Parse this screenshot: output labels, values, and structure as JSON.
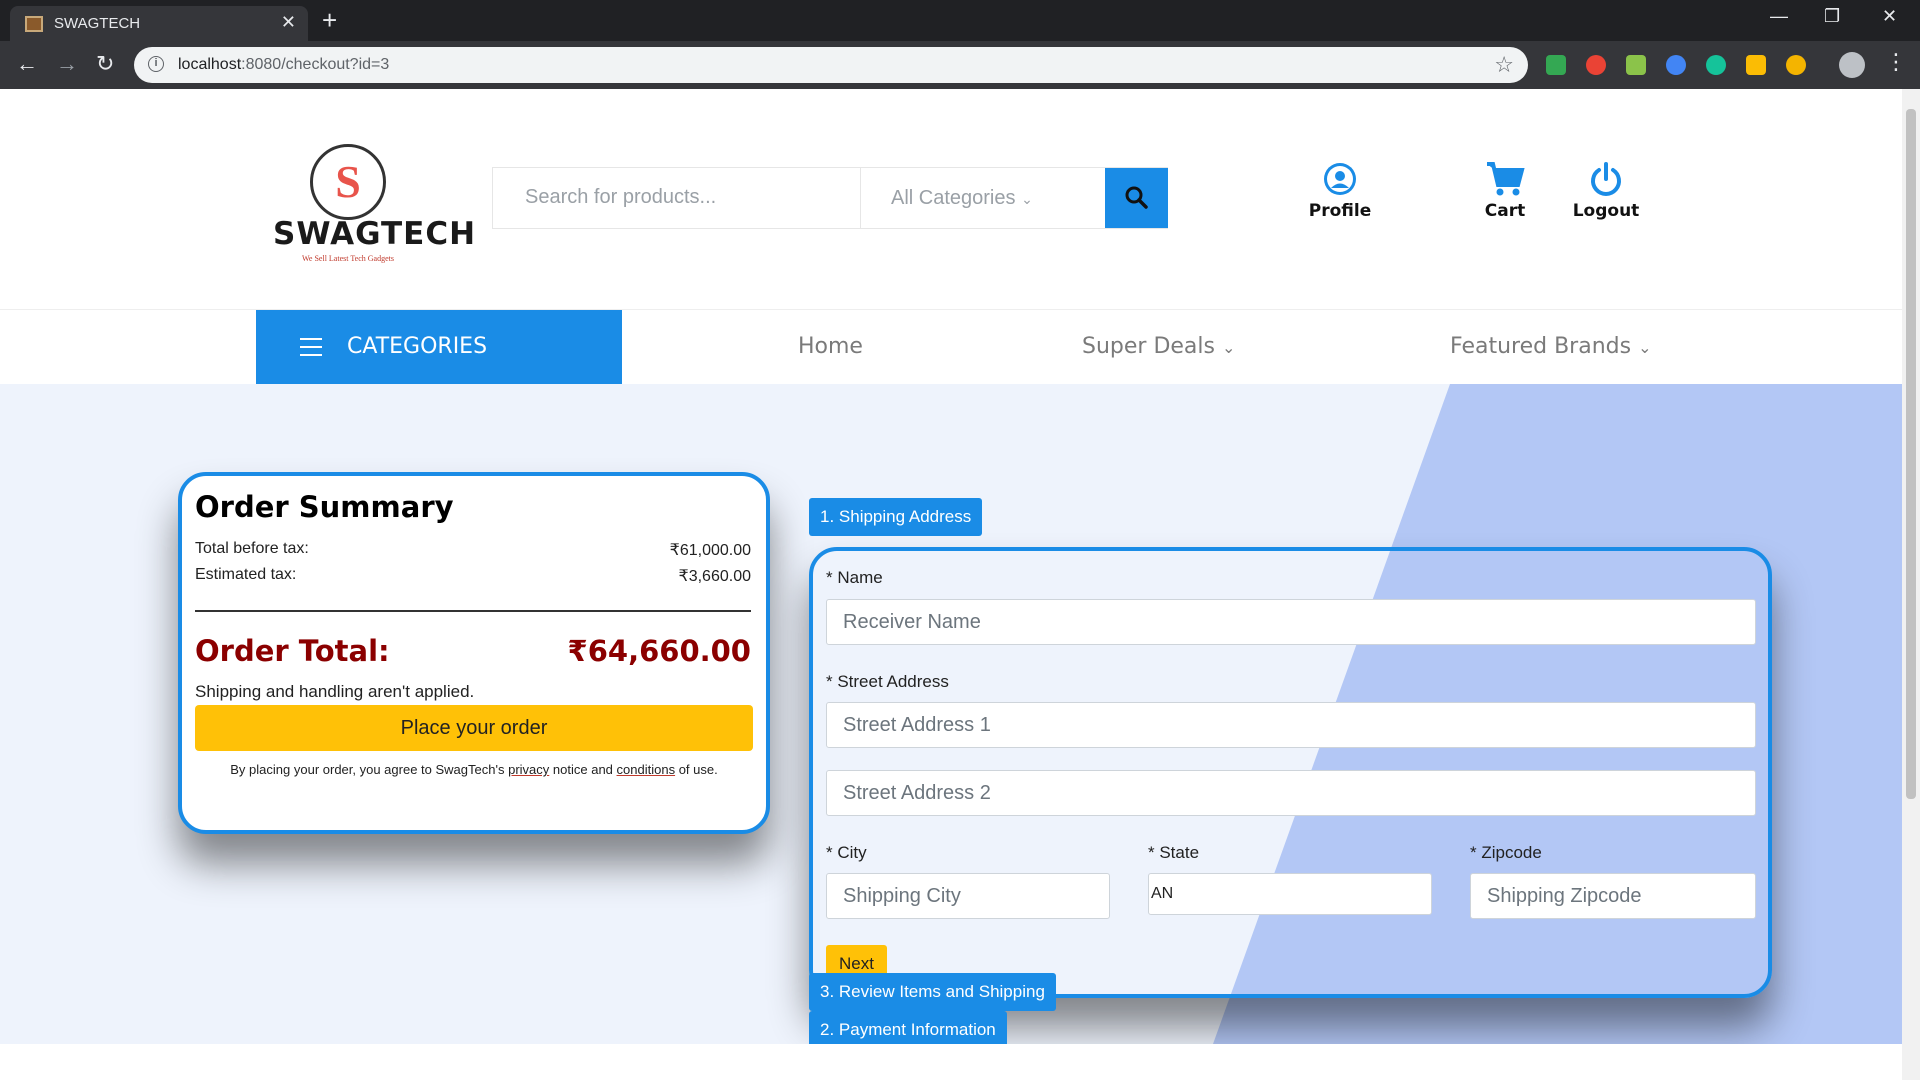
{
  "browser": {
    "tab_title": "SWAGTECH",
    "tab_close": "✕",
    "new_tab": "+",
    "url_host": "localhost",
    "url_rest": ":8080/checkout?id=3",
    "minimize": "—",
    "restore": "❐",
    "close": "✕"
  },
  "header": {
    "logo_text": "SWAGTECH",
    "logo_tagline": "We Sell Latest Tech Gadgets",
    "search_placeholder": "Search for products...",
    "category_select": "All Categories",
    "profile_label": "Profile",
    "cart_label": "Cart",
    "logout_label": "Logout"
  },
  "nav": {
    "categories_label": "CATEGORIES",
    "home": "Home",
    "super_deals": "Super Deals",
    "featured_brands": "Featured Brands"
  },
  "summary": {
    "title": "Order Summary",
    "before_tax_label": "Total before tax:",
    "before_tax_value": "₹61,000.00",
    "tax_label": "Estimated tax:",
    "tax_value": "₹3,660.00",
    "total_label": "Order Total:",
    "total_value": "₹64,660.00",
    "shipping_note": "Shipping and handling aren't applied.",
    "place_order": "Place your order",
    "legal_pre": "By placing your order, you agree to SwagTech's",
    "legal_privacy": "privacy",
    "legal_mid": "notice and",
    "legal_conditions": "conditions",
    "legal_post": "of use."
  },
  "steps": {
    "step1": "1. Shipping Address",
    "step2": "2. Payment Information",
    "step3": "3. Review Items and Shipping"
  },
  "form": {
    "name_label": "* Name",
    "name_placeholder": "Receiver Name",
    "street_label": "* Street Address",
    "street1_placeholder": "Street Address 1",
    "street2_placeholder": "Street Address 2",
    "city_label": "* City",
    "city_placeholder": "Shipping City",
    "state_label": "* State",
    "state_value": "AN",
    "zip_label": "* Zipcode",
    "zip_placeholder": "Shipping Zipcode",
    "next": "Next"
  },
  "colors": {
    "primary": "#1a8ce6",
    "accent": "#ffc107",
    "total": "#8b0000"
  }
}
